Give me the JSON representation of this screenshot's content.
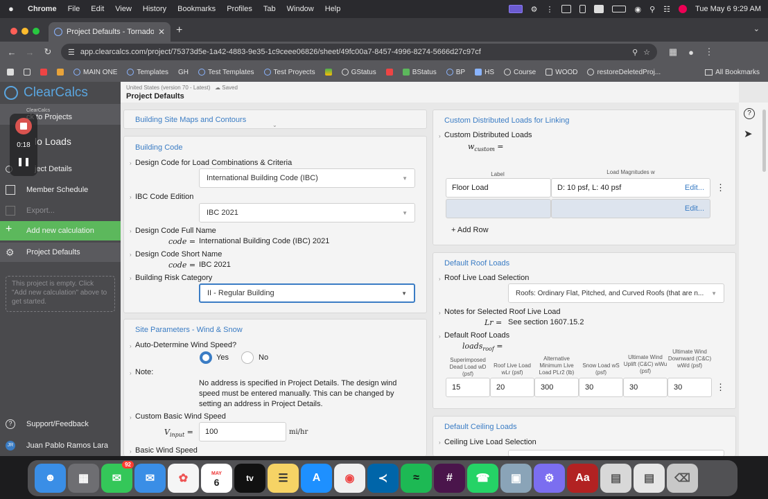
{
  "menubar": {
    "app": "Chrome",
    "items": [
      "File",
      "Edit",
      "View",
      "History",
      "Bookmarks",
      "Profiles",
      "Tab",
      "Window",
      "Help"
    ],
    "datetime": "Tue May 6  9:29 AM"
  },
  "browser": {
    "tab_title": "Project Defaults - Tornado Lo",
    "url": "app.clearcalcs.com/project/75373d5e-1a42-4883-9e35-1c9ceee06826/sheet/49fc00a7-8457-4996-8274-5666d27c97cf",
    "bookmarks": [
      "MAIN ONE",
      "Templates",
      "GH",
      "Test Templates",
      "Test Proyects",
      "GStatus",
      "BStatus",
      "BP",
      "HS",
      "Course",
      "WOOD",
      "restoreDeletedProj..."
    ],
    "all_bookmarks": "All Bookmarks"
  },
  "sidebar": {
    "brand": "ClearCalcs",
    "brand_small": "ClearCalcs",
    "back": "ck to Projects",
    "project": "lo Loads",
    "items": {
      "details": "ject Details",
      "schedule": "Member Schedule",
      "export": "Export...",
      "add": "Add new calculation",
      "defaults": "Project Defaults"
    },
    "empty_note": "This project is empty. Click \"Add new calculation\" above to get started.",
    "support": "Support/Feedback",
    "user": "Juan Pablo Ramos Lara",
    "user_initials": "JR",
    "recording_time": "0:18"
  },
  "header": {
    "locale": "United States (version 70 - Latest)",
    "saved": "Saved",
    "title": "Project Defaults"
  },
  "left": {
    "site_maps": "Building Site Maps and Contours",
    "building_code": {
      "title": "Building Code",
      "design_code_label": "Design Code for Load Combinations & Criteria",
      "design_code_value": "International Building Code (IBC)",
      "edition_label": "IBC Code Edition",
      "edition_value": "IBC 2021",
      "full_name_label": "Design Code Full Name",
      "full_name_sym": "code =",
      "full_name_value": "International Building Code (IBC) 2021",
      "short_name_label": "Design Code Short Name",
      "short_name_sym": "code =",
      "short_name_value": "IBC 2021",
      "risk_label": "Building Risk Category",
      "risk_value": "II - Regular Building"
    },
    "site_params": {
      "title": "Site Parameters - Wind & Snow",
      "auto_wind_label": "Auto-Determine Wind Speed?",
      "yes": "Yes",
      "no": "No",
      "note_label": "Note:",
      "note_text": "No address is specified in Project Details. The design wind speed must be entered manually. This can be changed by setting an address in Project Details.",
      "custom_wind_label": "Custom Basic Wind Speed",
      "custom_wind_sym": "V",
      "custom_wind_sub": "input",
      "custom_wind_value": "100",
      "custom_wind_unit": "mi/hr",
      "basic_wind_label": "Basic Wind Speed"
    }
  },
  "right": {
    "custom_loads": {
      "title": "Custom Distributed Loads for Linking",
      "label": "Custom Distributed Loads",
      "sym": "w",
      "sym_sub": "custom",
      "col_label": "Label",
      "col_mag": "Load Magnitudes w",
      "row1_label": "Floor Load",
      "row1_value": "D: 10 psf, L: 40 psf",
      "edit": "Edit...",
      "add_row": "Add Row"
    },
    "roof": {
      "title": "Default Roof Loads",
      "live_sel_label": "Roof Live Load Selection",
      "live_sel_value": "Roofs: Ordinary Flat, Pitched, and Curved Roofs (that are n...",
      "notes_label": "Notes for Selected Roof Live Load",
      "notes_sym": "Lr =",
      "notes_value": "See section 1607.15.2",
      "default_label": "Default Roof Loads",
      "default_sym": "loads",
      "default_sub": "roof",
      "columns": [
        "Superimposed Dead Load wD (psf)",
        "Roof Live Load wLr (psf)",
        "Alternative Minimum Live Load PLr2 (lb)",
        "Snow Load wS (psf)",
        "Ultimate Wind Uplift (C&C) wWu (psf)",
        "Ultimate Wind Downward (C&C) wWd (psf)"
      ],
      "values": [
        "15",
        "20",
        "300",
        "30",
        "30",
        "30"
      ]
    },
    "ceiling": {
      "title": "Default Ceiling Loads",
      "live_sel_label": "Ceiling Live Load Selection"
    }
  },
  "dock": {
    "badge": "92",
    "calendar_month": "MAY",
    "calendar_day": "6",
    "tv": "tv",
    "dict": "Aa"
  }
}
